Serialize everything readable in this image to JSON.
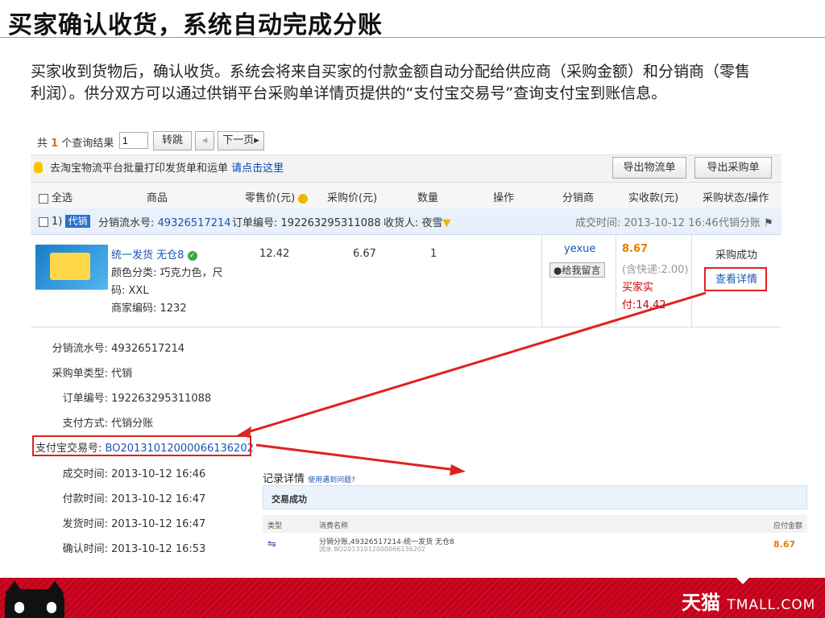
{
  "slide": {
    "title": "买家确认收货，系统自动完成分账",
    "intro": "买家收到货物后，确认收货。系统会将来自买家的付款金额自动分配给供应商（采购金额）和分销商（零售利润）。供分双方可以通过供销平台采购单详情页提供的“支付宝交易号”查询支付宝到账信息。"
  },
  "toolbar": {
    "total_prefix": "共",
    "total_count": "1",
    "total_suffix": "个查询结果",
    "page_value": "1",
    "jump_label": "转跳",
    "prev_label": "◂",
    "next_label": "下一页▸",
    "hint_text": "去淘宝物流平台批量打印发货单和运单",
    "hint_link": "请点击这里",
    "export_logistics": "导出物流单",
    "export_purchase": "导出采购单"
  },
  "table": {
    "headers": {
      "select_all": "全选",
      "product": "商品",
      "retail_price": "零售价(元)",
      "purchase_price": "采购价(元)",
      "quantity": "数量",
      "action": "操作",
      "distributor": "分销商",
      "received": "实收款(元)",
      "status": "采购状态/操作"
    },
    "order": {
      "index": "1)",
      "tag": "代销",
      "serial_label": "分销流水号:",
      "serial_value": "49326517214",
      "order_label": "订单编号:",
      "order_value": "192263295311088",
      "receiver_label": "收货人:",
      "receiver_value": "夜雪",
      "deal_time": "成交时间: 2013-10-12 16:46",
      "split_label": "代销分账"
    },
    "item": {
      "name": "统一发货 无仓8",
      "spec_line1": "颜色分类: 巧克力色，尺",
      "spec_line2": "码: XXL",
      "merchant_code": "商家编码: 1232",
      "retail": "12.42",
      "purchase": "6.67",
      "qty": "1",
      "distributor_name": "yexue",
      "message_label": "给我留言",
      "received_amount": "8.67",
      "shipping_note": "(含快递:2.00)",
      "buyer_paid_line1": "买家实",
      "buyer_paid_line2": "付:14.42",
      "status_text": "采购成功",
      "detail_link": "查看详情"
    }
  },
  "detail": {
    "serial": {
      "label": "分销流水号:",
      "value": "49326517214"
    },
    "type": {
      "label": "采购单类型:",
      "value": "代销"
    },
    "order": {
      "label": "订单编号:",
      "value": "192263295311088"
    },
    "pay_method": {
      "label": "支付方式:",
      "value": "代销分账"
    },
    "alipay_no": {
      "label": "支付宝交易号:",
      "value": "BO20131012000066136202"
    },
    "deal_time": {
      "label": "成交时间:",
      "value": "2013-10-12 16:46"
    },
    "pay_time": {
      "label": "付款时间:",
      "value": "2013-10-12 16:47"
    },
    "ship_time": {
      "label": "发货时间:",
      "value": "2013-10-12 16:47"
    },
    "confirm_time": {
      "label": "确认时间:",
      "value": "2013-10-12 16:53"
    }
  },
  "record": {
    "title": "记录详情",
    "help": "使用遇到问题?",
    "status": "交易成功",
    "col_type": "类型",
    "col_name": "消费名称",
    "col_amount": "应付金额",
    "row_name": "分销分账,49326517214-统一发货 无仓8",
    "row_serial": "流水 BO20131012000066136202",
    "row_amount": "8.67"
  },
  "footer": {
    "brand_cn": "天猫",
    "brand_en": "TMALL.COM"
  },
  "colors": {
    "accent_red": "#c4001a",
    "highlight_red": "#e02020",
    "link_blue": "#1a55b3",
    "amount_orange": "#e67c00"
  }
}
